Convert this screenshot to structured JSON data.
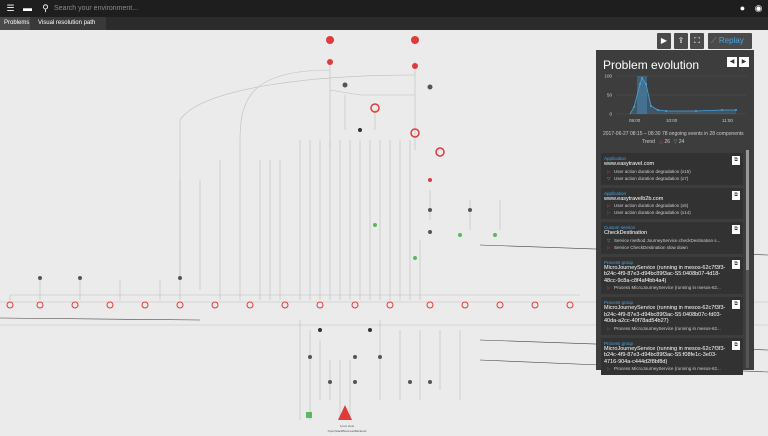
{
  "header": {
    "search_placeholder": "Search your environment..."
  },
  "breadcrumbs": [
    "Problems",
    "Visual resolution path"
  ],
  "toolbar": {
    "replay_label": "Replay"
  },
  "panel": {
    "title": "Problem evolution",
    "chart": {
      "y_ticks": [
        "100",
        "50",
        "0"
      ],
      "x_ticks": [
        "09:00",
        "10:00",
        "11:00"
      ]
    },
    "summary": "2017-06-27 08:15 – 08:30     78 ongoing events in 28 components",
    "trend_label": "Trend",
    "trend_up": "26",
    "trend_down": "24",
    "cards": [
      {
        "category": "Application",
        "name": "www.easytravel.com",
        "events": [
          {
            "mark": "▷",
            "color": "#e03b3b",
            "text": "User action duration degradation (x15)"
          },
          {
            "mark": "▽",
            "color": "#5cb85c",
            "text": "User action duration degradation (x7)"
          }
        ]
      },
      {
        "category": "Application",
        "name": "www.easytravelb2b.com",
        "events": [
          {
            "mark": "▷",
            "color": "#e03b3b",
            "text": "User action duration degradation (x5)"
          },
          {
            "mark": "▷",
            "color": "#e03b3b",
            "text": "User action duration degradation (x14)"
          }
        ]
      },
      {
        "category": "Custom service",
        "name": "CheckDestination",
        "events": [
          {
            "mark": "▽",
            "color": "#5cb85c",
            "text": "Service method JourneyService.checkDestination s..."
          },
          {
            "mark": "▷",
            "color": "#e03b3b",
            "text": "Service CheckDestination slow down"
          }
        ]
      },
      {
        "category": "Process group",
        "name": "MicroJourneyService (running in mesos-62c7f3f3-b24c-4f9-87e3-d94bc89f3ac-S5:0408b07-4d18-48cc-9c8a-c8f4af4bb4a4)",
        "events": [
          {
            "mark": "▷",
            "color": "#e03b3b",
            "text": "Process MicroJourneyService (running in mesos-62..."
          }
        ]
      },
      {
        "category": "Process group",
        "name": "MicroJourneyService (running in mesos-62c7f3f3-b24c-4f9-87e3-d94bc89f3ac-S5:0408b07c-fd03-40da-a2cc-40f78ad54b27)",
        "events": [
          {
            "mark": "▷",
            "color": "#e03b3b",
            "text": "Process MicroJourneyService (running in mesos-62..."
          }
        ]
      },
      {
        "category": "Process group",
        "name": "MicroJourneyService (running in mesos-62c7f3f3-b24c-4f9-87e3-d94bc89f3ac-S5:f08fe1c-3e03-4716-904a-c444d2f8bf8d)",
        "events": [
          {
            "mark": "▷",
            "color": "#e03b3b",
            "text": "Process MicroJourneyService (running in mesos-62..."
          }
        ]
      }
    ]
  },
  "graph": {
    "bottom_node_label": "OpenStackBusinessBackend",
    "bottom_node_sub": "Linux Host"
  },
  "colors": {
    "accent": "#4aa3df",
    "error": "#e03b3b",
    "ok": "#5cb85c",
    "panel": "#3d3d3d",
    "topbar": "#1e1e1e"
  },
  "icons": [
    "menu-icon",
    "chat-icon",
    "search-icon",
    "notification-icon",
    "user-icon",
    "play-icon",
    "upload-icon",
    "fullscreen-icon",
    "replay-chart-icon"
  ]
}
